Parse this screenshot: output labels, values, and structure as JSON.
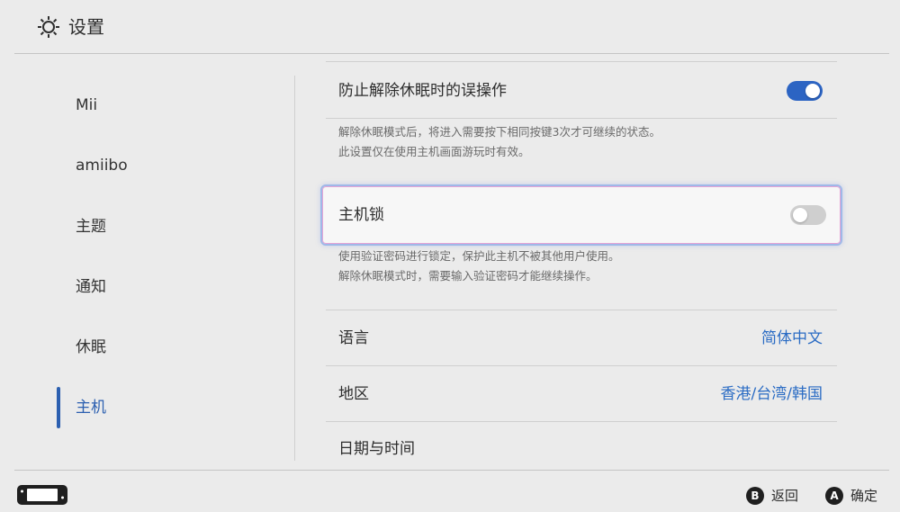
{
  "header": {
    "title": "设置",
    "icon": "gear-icon"
  },
  "sidebar": {
    "items": [
      {
        "label": "Mii"
      },
      {
        "label": "amiibo"
      },
      {
        "label": "主题"
      },
      {
        "label": "通知"
      },
      {
        "label": "休眠"
      },
      {
        "label": "主机",
        "active": true
      }
    ]
  },
  "settings": {
    "prevent_wake": {
      "label": "防止解除休眠时的误操作",
      "enabled": true,
      "desc_line1": "解除休眠模式后，将进入需要按下相同按键3次才可继续的状态。",
      "desc_line2": "此设置仅在使用主机画面游玩时有效。"
    },
    "console_lock": {
      "label": "主机锁",
      "enabled": false,
      "desc_line1": "使用验证密码进行锁定，保护此主机不被其他用户使用。",
      "desc_line2": "解除休眠模式时，需要输入验证密码才能继续操作。"
    },
    "language": {
      "label": "语言",
      "value": "简体中文"
    },
    "region": {
      "label": "地区",
      "value": "香港/台湾/韩国"
    },
    "datetime": {
      "label": "日期与时间"
    }
  },
  "footer": {
    "back": {
      "key": "B",
      "label": "返回"
    },
    "ok": {
      "key": "A",
      "label": "确定"
    }
  },
  "colors": {
    "accent": "#2b6cc4",
    "toggle_on": "#2c64c3"
  }
}
